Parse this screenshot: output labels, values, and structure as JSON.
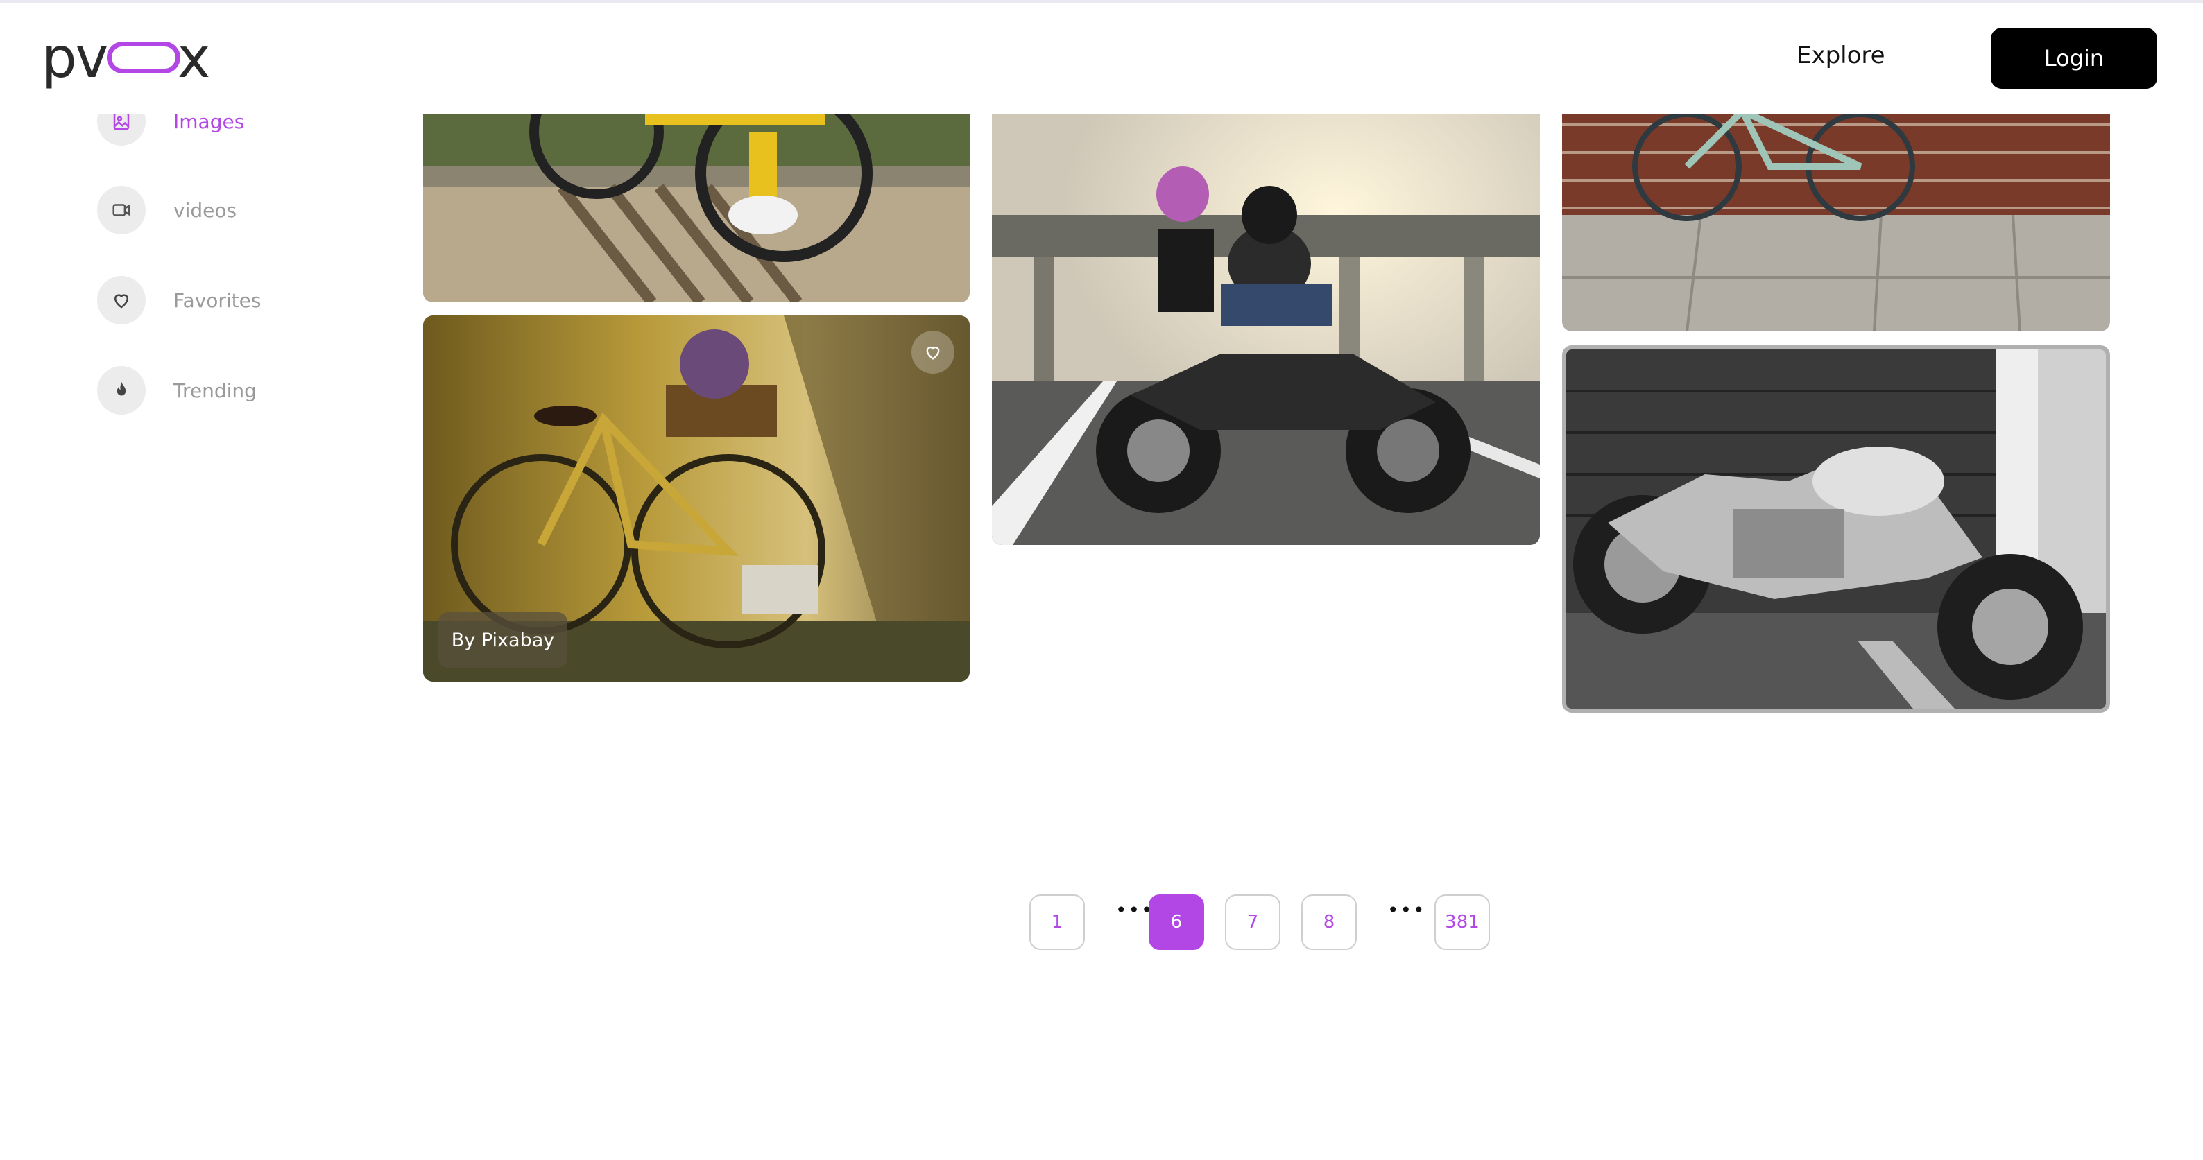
{
  "header": {
    "logo_left": "pv",
    "logo_right": "x",
    "explore": "Explore",
    "login": "Login"
  },
  "sidebar": {
    "items": [
      {
        "label": "Images",
        "icon": "image-icon",
        "active": true
      },
      {
        "label": "videos",
        "icon": "video-icon",
        "active": false
      },
      {
        "label": "Favorites",
        "icon": "heart-icon",
        "active": false
      },
      {
        "label": "Trending",
        "icon": "fire-icon",
        "active": false
      }
    ]
  },
  "gallery": {
    "credit_label": "By Pixabay"
  },
  "pagination": {
    "pages": [
      "1",
      "6",
      "7",
      "8",
      "381"
    ],
    "current": "6",
    "ellipsis": "•••"
  },
  "colors": {
    "accent": "#b347e6",
    "login_bg": "#000000"
  }
}
